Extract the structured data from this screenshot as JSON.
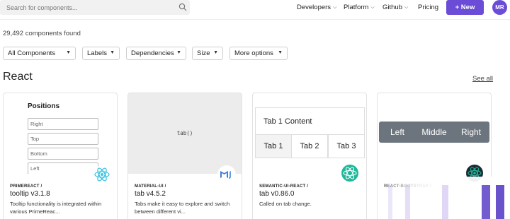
{
  "search": {
    "placeholder": "Search for components..."
  },
  "nav": {
    "developers": "Developers",
    "platform": "Platform",
    "github": "Github",
    "pricing": "Pricing",
    "new_button": "+ New",
    "avatar_initials": "MR"
  },
  "results": {
    "count_text": "29,492 components found"
  },
  "filters": [
    "All Components",
    "Labels",
    "Dependencies",
    "Size",
    "More options"
  ],
  "section": {
    "title": "React",
    "see_all": "See all"
  },
  "cards": [
    {
      "package": "PRIMEREACT /",
      "name": "tooltip v3.1.8",
      "description": "Tooltip functionality is integrated within various PrimeReac...",
      "preview": {
        "title": "Positions",
        "inputs": [
          "Right",
          "Top",
          "Bottom",
          "Left"
        ]
      },
      "badge_color": "#41c4e0"
    },
    {
      "package": "MATERIAL-UI /",
      "name": "tab v4.5.2",
      "description": "Tabs make it easy to explore and switch between different vi...",
      "preview": {
        "code": "tab()"
      },
      "badge_color": "#3f7fd6"
    },
    {
      "package": "SEMANTIC-UI-REACT /",
      "name": "tab v0.86.0",
      "description": "Called on tab change.",
      "preview": {
        "content": "Tab 1 Content",
        "tabs": [
          "Tab 1",
          "Tab 2",
          "Tab 3"
        ]
      },
      "badge_color": "#1fb89b"
    },
    {
      "package": "REACT-BOOTSTRAP /",
      "name": "",
      "description": "",
      "preview": {
        "buttons": [
          "Left",
          "Middle",
          "Right"
        ]
      },
      "badge_color": "#1fb89b"
    }
  ]
}
